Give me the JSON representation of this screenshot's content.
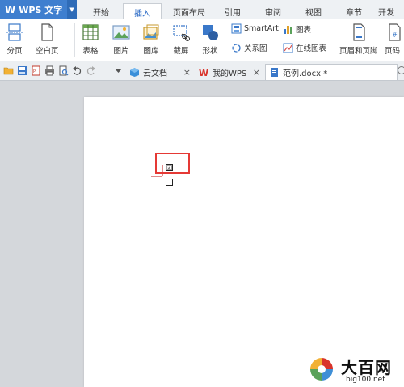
{
  "app": {
    "title": "WPS 文字"
  },
  "ribbon_tabs": [
    "开始",
    "插入",
    "页面布局",
    "引用",
    "审阅",
    "视图",
    "章节",
    "开发"
  ],
  "active_ribbon_tab": "插入",
  "ribbon": {
    "page_break": "分页",
    "blank_page": "空白页",
    "table": "表格",
    "picture": "图片",
    "gallery": "图库",
    "screenshot": "截屏",
    "shapes": "形状",
    "smartart": "SmartArt",
    "chart": "图表",
    "relation_diagram": "关系图",
    "online_chart": "在线图表",
    "header_footer": "页眉和页脚",
    "page_number": "页码"
  },
  "doc_tabs": [
    {
      "label": "云文档"
    },
    {
      "label": "我的WPS"
    },
    {
      "label": "范例.docx *"
    }
  ],
  "document": {
    "checkbox1_checked": true,
    "checkbox1_glyph": "☑",
    "checkbox2_checked": false
  },
  "watermark": {
    "title": "大百网",
    "url": "big100.net"
  },
  "colors": {
    "accent": "#3f7fcf",
    "highlight": "#e53935",
    "page": "#ffffff",
    "workspace": "#d4d7db"
  }
}
